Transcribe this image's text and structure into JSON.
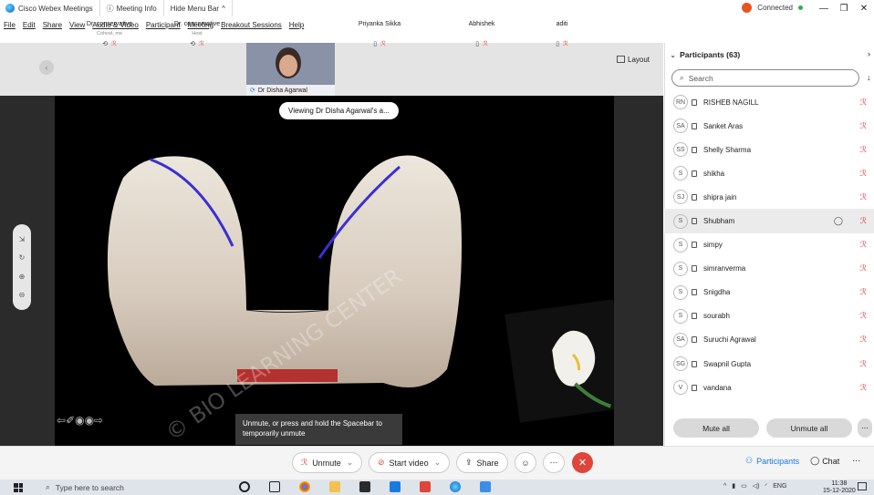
{
  "titlebar": {
    "app_name": "Cisco Webex Meetings",
    "meeting_info": "Meeting Info",
    "hide_menu": "Hide Menu Bar",
    "connection": "Connected",
    "window_controls": [
      "—",
      "❐",
      "✕"
    ]
  },
  "menu": [
    "File",
    "Edit",
    "Share",
    "View",
    "Audio & Video",
    "Participant",
    "Meeting",
    "Breakout Sessions",
    "Help"
  ],
  "filmstrip": {
    "thumbs": [
      {
        "name": "Dr. conservative",
        "sub": "Cohost, me"
      },
      {
        "name": "Dr. conservative",
        "sub": "Host"
      },
      {
        "name": "Priyanka Sikka",
        "sub": ""
      },
      {
        "name": "Abhishek",
        "sub": ""
      },
      {
        "name": "aditi",
        "sub": ""
      }
    ],
    "presenter_name": "Dr Disha Agarwal",
    "layout_label": "Layout"
  },
  "stage": {
    "viewing_label": "Viewing Dr Disha Agarwal's a...",
    "watermark": "© BIO LEARNING CENTER",
    "unmute_tip": "Unmute, or press and hold the Spacebar to temporarily unmute",
    "annotation_tools": "⇦✐◉◉⇨"
  },
  "controls": {
    "unmute": "Unmute",
    "start_video": "Start video",
    "share": "Share",
    "participants": "Participants",
    "chat": "Chat"
  },
  "panel": {
    "title": "Participants (63)",
    "search_placeholder": "Search",
    "participants": [
      {
        "initials": "RN",
        "name": "RISHEB NAGILL"
      },
      {
        "initials": "SA",
        "name": "Sanket Aras"
      },
      {
        "initials": "SS",
        "name": "Shelly Sharma"
      },
      {
        "initials": "S",
        "name": "shikha"
      },
      {
        "initials": "SJ",
        "name": "shipra jain"
      },
      {
        "initials": "S",
        "name": "Shubham"
      },
      {
        "initials": "S",
        "name": "simpy"
      },
      {
        "initials": "S",
        "name": "simranverma"
      },
      {
        "initials": "S",
        "name": "Snigdha"
      },
      {
        "initials": "S",
        "name": "sourabh"
      },
      {
        "initials": "SA",
        "name": "Suruchi Agrawal"
      },
      {
        "initials": "SG",
        "name": "Swapnil Gupta"
      },
      {
        "initials": "V",
        "name": "vandana"
      }
    ],
    "mute_all": "Mute all",
    "unmute_all": "Unmute all"
  },
  "taskbar": {
    "search_text": "Type here to search",
    "language": "ENG",
    "time": "11:38",
    "date": "15-12-2020"
  },
  "colors": {
    "accent_red": "#e0443b",
    "brand_blue": "#1a7ae0",
    "annotation_blue": "#3a2ed4"
  }
}
